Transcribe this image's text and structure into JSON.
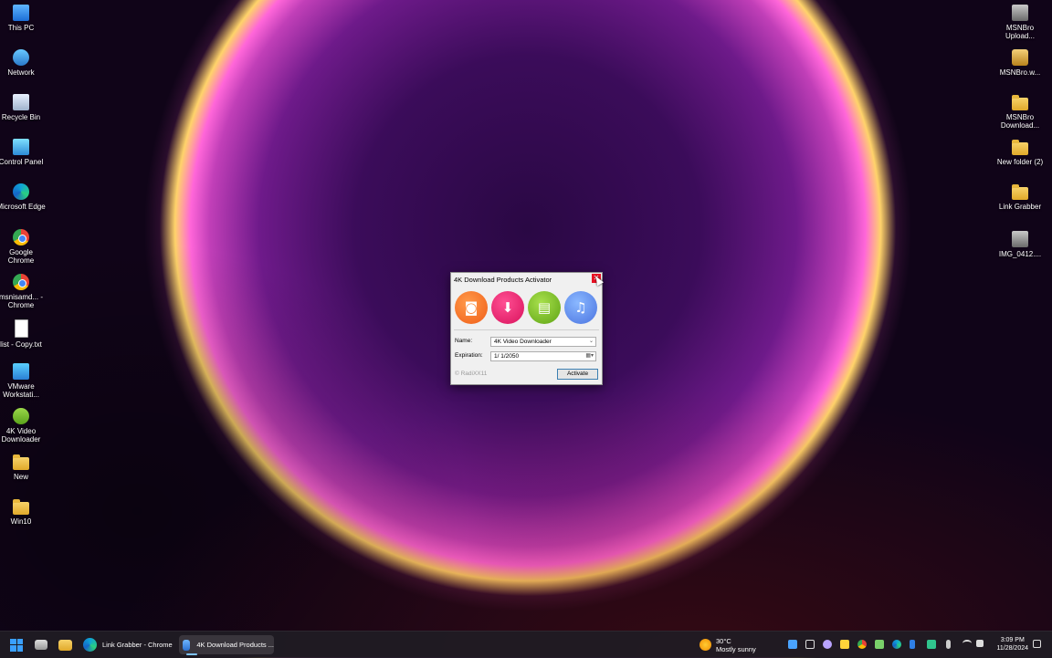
{
  "desktop": {
    "left_icons": [
      {
        "label": "This PC",
        "icon": "this-pc-icon"
      },
      {
        "label": "Network",
        "icon": "network-icon"
      },
      {
        "label": "Recycle Bin",
        "icon": "recycle-bin-icon"
      },
      {
        "label": "Control Panel",
        "icon": "control-panel-icon"
      },
      {
        "label": "Microsoft Edge",
        "icon": "edge-icon"
      },
      {
        "label": "Google Chrome",
        "icon": "chrome-icon"
      },
      {
        "label": "msnisamd... - Chrome",
        "icon": "chrome-shortcut-icon"
      },
      {
        "label": "list - Copy.txt",
        "icon": "text-file-icon"
      },
      {
        "label": "VMware Workstati...",
        "icon": "vmware-icon"
      },
      {
        "label": "4K Video Downloader",
        "icon": "4k-video-downloader-icon"
      },
      {
        "label": "New",
        "icon": "folder-icon"
      },
      {
        "label": "Win10",
        "icon": "folder-icon"
      }
    ],
    "right_icons": [
      {
        "label": "MSNBro Upload...",
        "icon": "image-file-icon"
      },
      {
        "label": "MSNBro.w...",
        "icon": "msnbro-file-icon"
      },
      {
        "label": "MSNBro Download...",
        "icon": "folder-icon"
      },
      {
        "label": "New folder (2)",
        "icon": "folder-icon"
      },
      {
        "label": "Link Grabber",
        "icon": "folder-icon"
      },
      {
        "label": "IMG_0412....",
        "icon": "image-file-icon"
      }
    ]
  },
  "dialog": {
    "title": "4K Download Products Activator",
    "close_glyph": "✕",
    "products": [
      {
        "name": "4K Stogram",
        "icon": "camera-icon",
        "color": "#f26a22"
      },
      {
        "name": "4K Video Downloader",
        "icon": "download-arrow-icon",
        "color": "#e8186f"
      },
      {
        "name": "4K Slideshow Maker",
        "icon": "slideshow-icon",
        "color": "#6eb21e"
      },
      {
        "name": "4K YouTube to MP3",
        "icon": "cloud-music-icon",
        "color": "#5a86ea"
      }
    ],
    "name_label": "Name:",
    "name_value": "4K Video Downloader",
    "expiration_label": "Expiration:",
    "expiration_value": "1/  1/2050",
    "credit": "© RadiXX11",
    "activate_label": "Activate"
  },
  "taskbar": {
    "apps": [
      {
        "label": "",
        "icon": "start-icon"
      },
      {
        "label": "",
        "icon": "task-view-icon"
      },
      {
        "label": "",
        "icon": "file-explorer-icon"
      },
      {
        "label": "Link Grabber - Chrome",
        "icon": "edge-icon"
      },
      {
        "label": "4K Download Products ...",
        "icon": "activator-icon"
      }
    ],
    "weather": {
      "temp": "30°C",
      "desc": "Mostly sunny"
    },
    "clock": {
      "time": "3:09 PM",
      "date": "11/28/2024"
    }
  },
  "colors": {
    "accent": "#3aa0ff",
    "close_red": "#e81123"
  }
}
